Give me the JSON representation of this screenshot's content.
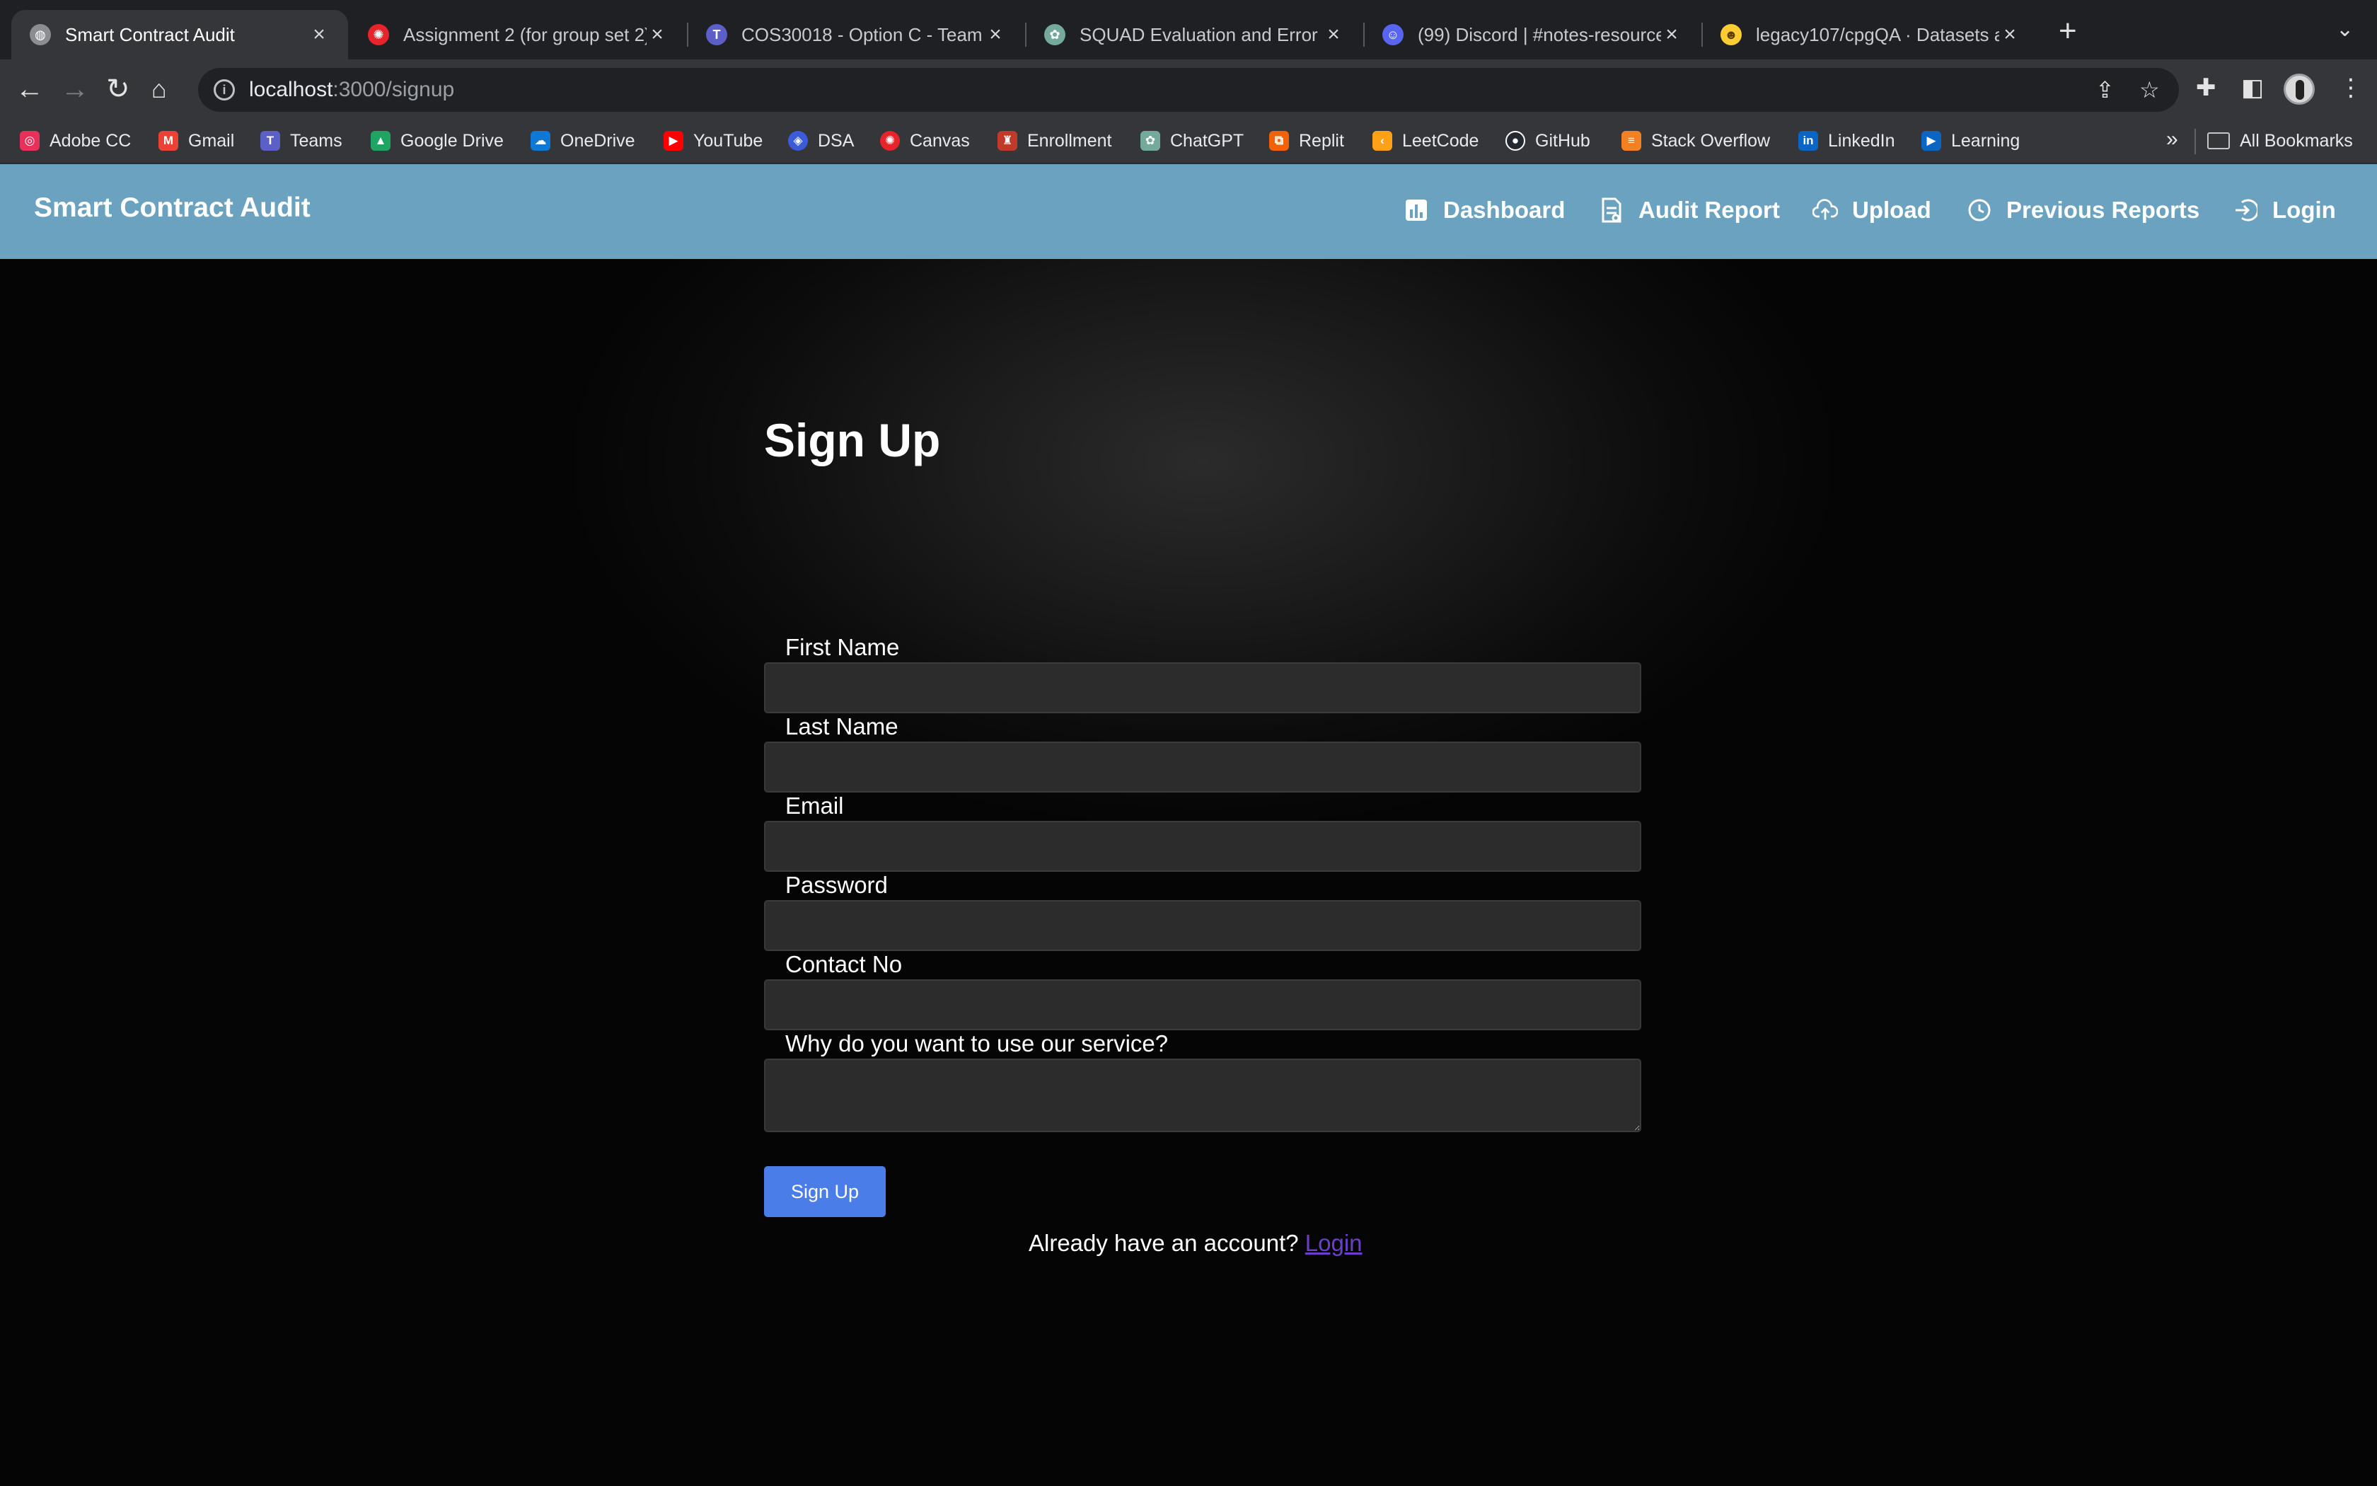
{
  "browser": {
    "tabs": [
      {
        "title": "Smart Contract Audit",
        "active": true,
        "favicon": "globe-icon"
      },
      {
        "title": "Assignment 2 (for group set 2)",
        "active": false,
        "favicon": "canvas-icon"
      },
      {
        "title": "COS30018 - Option C - Team",
        "active": false,
        "favicon": "teams-icon"
      },
      {
        "title": "SQUAD Evaluation and Error",
        "active": false,
        "favicon": "chatgpt-icon"
      },
      {
        "title": "(99) Discord | #notes-resources",
        "active": false,
        "favicon": "discord-icon"
      },
      {
        "title": "legacy107/cpgQA · Datasets at",
        "active": false,
        "favicon": "huggingface-icon"
      }
    ],
    "url_host": "localhost",
    "url_path": ":3000/signup",
    "bookmarks": [
      {
        "label": "Adobe CC",
        "color": "#e8305a"
      },
      {
        "label": "Gmail",
        "color": "#ea4335"
      },
      {
        "label": "Teams",
        "color": "#5b5fc7"
      },
      {
        "label": "Google Drive",
        "color": "#1fa463"
      },
      {
        "label": "OneDrive",
        "color": "#0f78d4"
      },
      {
        "label": "YouTube",
        "color": "#ff0000"
      },
      {
        "label": "DSA",
        "color": "#3b5bdb"
      },
      {
        "label": "Canvas",
        "color": "#e72429"
      },
      {
        "label": "Enrollment",
        "color": "#c0392b"
      },
      {
        "label": "ChatGPT",
        "color": "#74aa9c"
      },
      {
        "label": "Replit",
        "color": "#f26207"
      },
      {
        "label": "LeetCode",
        "color": "#ffa116"
      },
      {
        "label": "GitHub",
        "color": "#24292f"
      },
      {
        "label": "Stack Overflow",
        "color": "#f48024"
      },
      {
        "label": "LinkedIn",
        "color": "#0a66c2"
      },
      {
        "label": "Learning",
        "color": "#0a66c2"
      }
    ],
    "all_bookmarks": "All Bookmarks"
  },
  "app": {
    "brand": "Smart Contract Audit",
    "nav": [
      {
        "label": "Dashboard",
        "icon": "bar-chart-icon"
      },
      {
        "label": "Audit Report",
        "icon": "report-icon"
      },
      {
        "label": "Upload",
        "icon": "cloud-upload-icon"
      },
      {
        "label": "Previous Reports",
        "icon": "clock-icon"
      },
      {
        "label": "Login",
        "icon": "login-icon"
      }
    ],
    "accent": "#6aa2c0"
  },
  "signup": {
    "title": "Sign Up",
    "fields": {
      "first_name": "First Name",
      "last_name": "Last Name",
      "email": "Email",
      "password": "Password",
      "contact": "Contact No",
      "reason": "Why do you want to use our service?"
    },
    "submit": "Sign Up",
    "already_text": "Already have an account?",
    "login_link": "Login",
    "button_color": "#4a7de8"
  }
}
